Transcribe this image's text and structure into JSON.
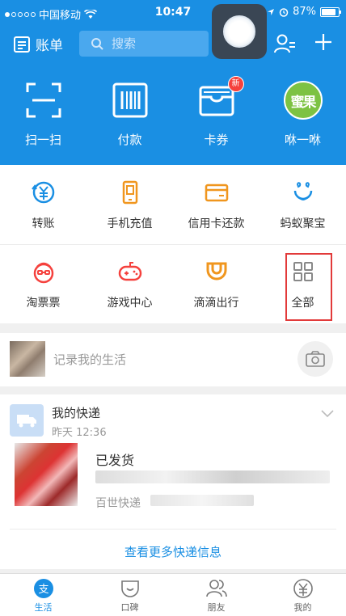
{
  "statusbar": {
    "carrier": "中国移动",
    "time": "10:47",
    "battery": "87%"
  },
  "header": {
    "bill_label": "账单",
    "search_placeholder": "搜索",
    "big_actions": [
      {
        "label": "扫一扫",
        "icon": "scan-icon"
      },
      {
        "label": "付款",
        "icon": "barcode-icon"
      },
      {
        "label": "卡券",
        "icon": "wallet-icon",
        "badge": "新"
      },
      {
        "label": "咻一咻",
        "icon": "miyu-icon",
        "logo_text": "蜜果"
      }
    ]
  },
  "grid": {
    "row1": [
      {
        "label": "转账",
        "icon": "transfer-icon"
      },
      {
        "label": "手机充值",
        "icon": "phone-icon"
      },
      {
        "label": "信用卡还款",
        "icon": "credit-card-icon"
      },
      {
        "label": "蚂蚁聚宝",
        "icon": "ant-fortune-icon"
      }
    ],
    "row2": [
      {
        "label": "淘票票",
        "icon": "movie-ticket-icon"
      },
      {
        "label": "游戏中心",
        "icon": "gamepad-icon"
      },
      {
        "label": "滴滴出行",
        "icon": "didi-icon"
      },
      {
        "label": "全部",
        "icon": "grid-all-icon"
      }
    ]
  },
  "life": {
    "placeholder": "记录我的生活"
  },
  "express": {
    "title": "我的快递",
    "time": "昨天 12:36",
    "status": "已发货",
    "courier": "百世快递",
    "more_link": "查看更多快递信息"
  },
  "tabbar": [
    {
      "label": "生活",
      "active": true
    },
    {
      "label": "口碑",
      "active": false
    },
    {
      "label": "朋友",
      "active": false
    },
    {
      "label": "我的",
      "active": false
    }
  ],
  "colors": {
    "brand": "#1a8fe3",
    "orange": "#f0961e",
    "red": "#f5413d",
    "highlight": "#e23a3a"
  }
}
